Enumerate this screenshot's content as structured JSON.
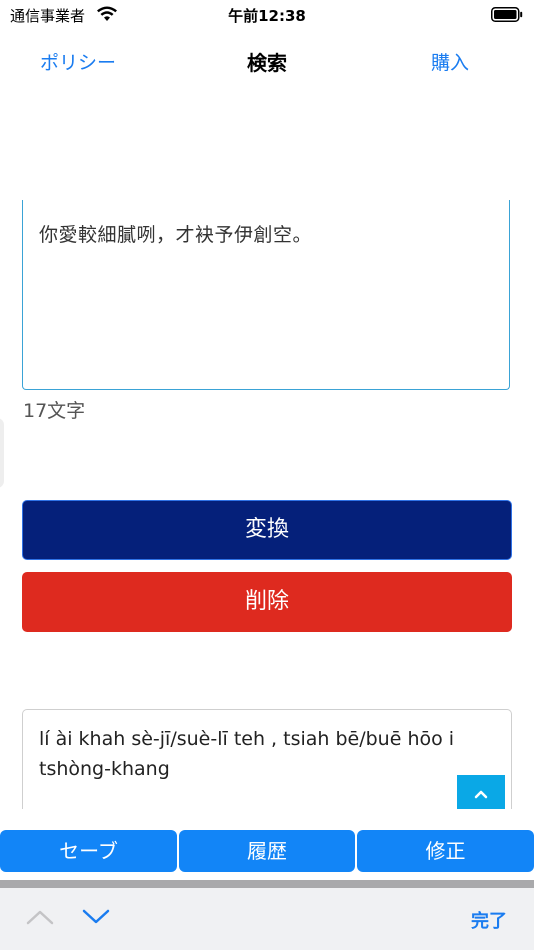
{
  "status_bar": {
    "carrier": "通信事業者",
    "time": "午前12:38"
  },
  "nav": {
    "left_label": "ポリシー",
    "title": "検索",
    "right_label": "購入"
  },
  "input": {
    "text": "你愛較細膩咧，才袂予伊創空。",
    "char_count": "17文字"
  },
  "buttons": {
    "convert": "変換",
    "delete": "削除"
  },
  "result": {
    "text": "lí ài khah sè-jī/suè-lī teh , tsiah bē/buē hōo i tshòng-khang"
  },
  "tabs": {
    "save": "セーブ",
    "history": "履歴",
    "fix": "修正"
  },
  "accessory": {
    "done": "完了"
  },
  "colors": {
    "accent": "#1a7cf0",
    "convert_bg": "#05207a",
    "delete_bg": "#de2a1f",
    "tab_bg": "#1285f7",
    "scroll_button": "#0aa8e6"
  }
}
